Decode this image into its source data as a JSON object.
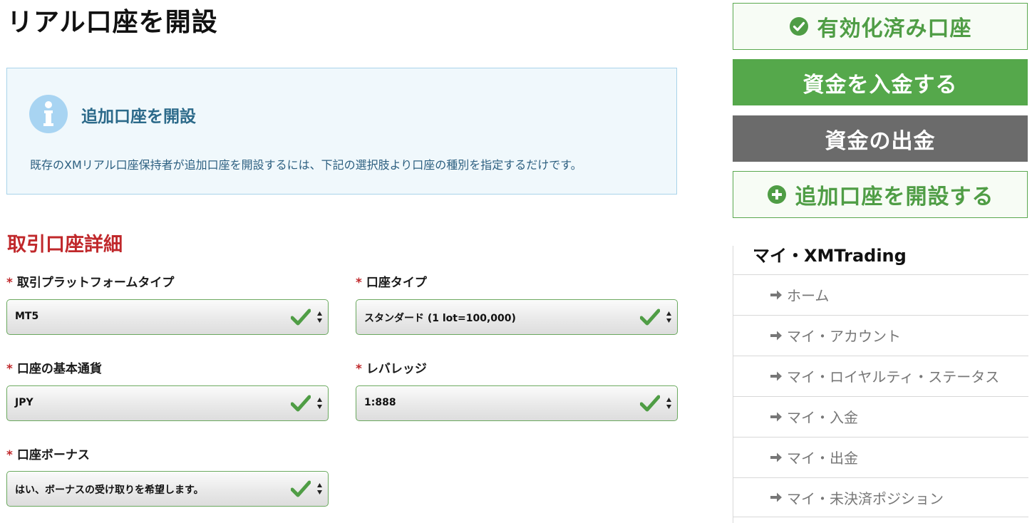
{
  "page": {
    "title": "リアル口座を開設"
  },
  "info": {
    "title": "追加口座を開設",
    "text": "既存のXMリアル口座保持者が追加口座を開設するには、下記の選択肢より口座の種別を指定するだけです。"
  },
  "form": {
    "section_title": "取引口座詳細",
    "required_mark": "*",
    "fields": [
      {
        "label": "取引プラットフォームタイプ",
        "value": "MT5"
      },
      {
        "label": "口座タイプ",
        "value": "スタンダード (1 lot=100,000)"
      },
      {
        "label": "口座の基本通貨",
        "value": "JPY"
      },
      {
        "label": "レバレッジ",
        "value": "1:888"
      },
      {
        "label": "口座ボーナス",
        "value": "はい、ボーナスの受け取りを希望します。"
      }
    ]
  },
  "sidebar": {
    "buttons": {
      "verified": "有効化済み口座",
      "deposit": "資金を入金する",
      "withdraw": "資金の出金",
      "add_account": "追加口座を開設する"
    },
    "nav_title": "マイ・XMTrading",
    "nav_items": [
      "ホーム",
      "マイ・アカウント",
      "マイ・ロイヤルティ・ステータス",
      "マイ・入金",
      "マイ・出金",
      "マイ・未決済ポジション"
    ]
  },
  "colors": {
    "green": "#55a84b",
    "gray": "#6b6b6b",
    "red": "#c0282b",
    "info_bg": "#f0f8fc",
    "info_border": "#a9d3ea"
  }
}
